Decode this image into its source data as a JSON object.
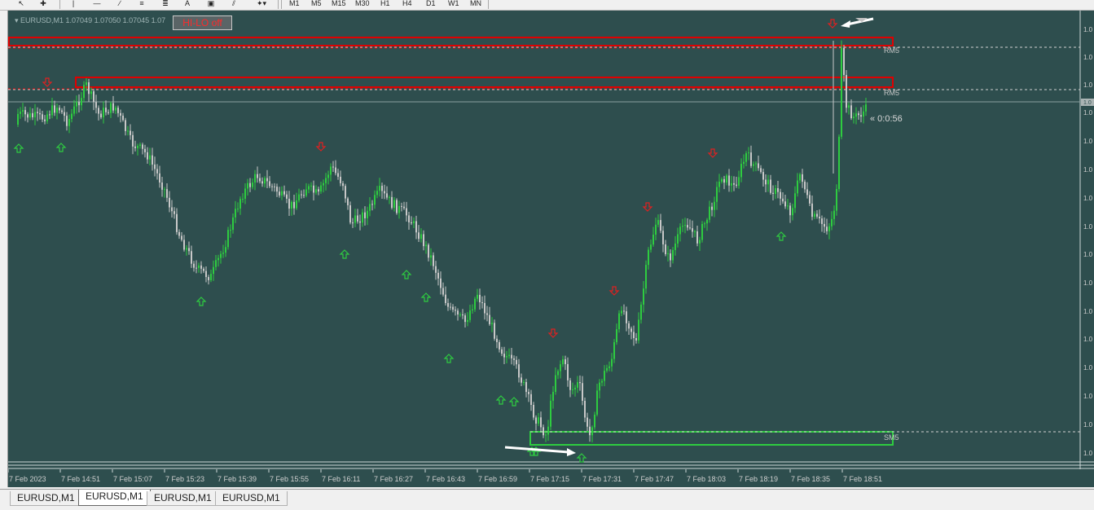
{
  "toolbar": {
    "tools": [
      "cursor-tool",
      "crosshair-tool",
      "vertical-line-tool",
      "horizontal-line-tool",
      "trendline-tool",
      "fibonacci-tool",
      "fibonacci-fan-tool",
      "text-tool",
      "text-label-tool",
      "channel-tool",
      "shapes-dropdown"
    ],
    "text_tool_label": "A",
    "timeframes": [
      "M1",
      "M5",
      "M15",
      "M30",
      "H1",
      "H4",
      "D1",
      "W1",
      "MN"
    ]
  },
  "chart": {
    "symbol_info": "EURUSD,M1  1.07049 1.07050 1.07045 1.07",
    "hilo_button": "HI-LO off",
    "countdown": "« 0:0:56",
    "zones": {
      "resistance_label": "RM5",
      "support_label": "SM5"
    },
    "price_axis_label": "1.0",
    "current_price_label": "1.0",
    "x_labels": [
      "7 Feb 2023",
      "7 Feb 14:51",
      "7 Feb 15:07",
      "7 Feb 15:23",
      "7 Feb 15:39",
      "7 Feb 15:55",
      "7 Feb 16:11",
      "7 Feb 16:27",
      "7 Feb 16:43",
      "7 Feb 16:59",
      "7 Feb 17:15",
      "7 Feb 17:31",
      "7 Feb 17:47",
      "7 Feb 18:03",
      "7 Feb 18:19",
      "7 Feb 18:35",
      "7 Feb 18:51"
    ],
    "colors": {
      "background": "#2e4e4e",
      "bull": "#2ecc40",
      "bear": "#c8c8c8",
      "arrow_up": "#2ecc40",
      "arrow_down": "#e02020",
      "resistance": "#e00000",
      "support": "#2ecc40"
    }
  },
  "tabs": [
    "EURUSD,M1",
    "EURUSD,M1",
    "EURUSD,M1",
    "EURUSD,M1"
  ],
  "active_tab": 1
}
